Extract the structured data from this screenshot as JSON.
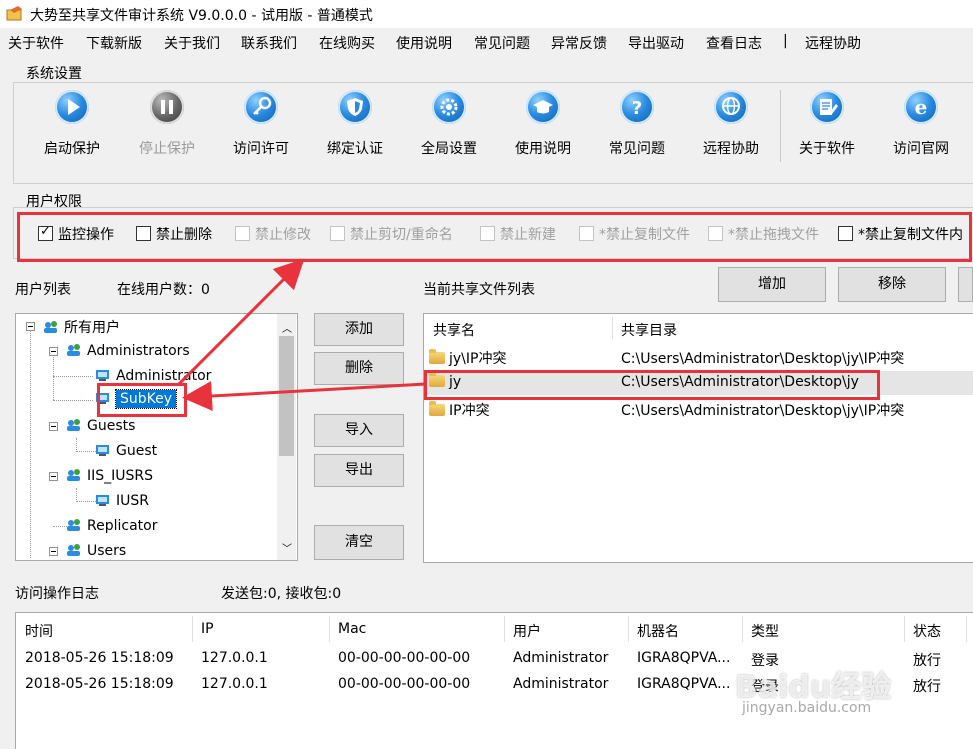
{
  "window": {
    "title": "大势至共享文件审计系统 V9.0.0.0 - 试用版 - 普通模式"
  },
  "menu": [
    "关于软件",
    "下载新版",
    "关于我们",
    "联系我们",
    "在线购买",
    "使用说明",
    "常见问题",
    "异常反馈",
    "导出驱动",
    "查看日志",
    "|",
    "远程协助"
  ],
  "system_settings": {
    "label": "系统设置",
    "buttons": [
      {
        "label": "启动保护",
        "icon": "play-icon",
        "enabled": true
      },
      {
        "label": "停止保护",
        "icon": "pause-icon",
        "enabled": false
      },
      {
        "label": "访问许可",
        "icon": "key-icon",
        "enabled": true
      },
      {
        "label": "绑定认证",
        "icon": "shield-icon",
        "enabled": true
      },
      {
        "label": "全局设置",
        "icon": "gear-icon",
        "enabled": true
      },
      {
        "label": "使用说明",
        "icon": "graduation-cap-icon",
        "enabled": true
      },
      {
        "label": "常见问题",
        "icon": "question-icon",
        "enabled": true
      },
      {
        "label": "远程协助",
        "icon": "globe-icon",
        "enabled": true
      },
      {
        "label": "关于软件",
        "icon": "document-edit-icon",
        "enabled": true
      },
      {
        "label": "访问官网",
        "icon": "ie-icon",
        "enabled": true
      }
    ]
  },
  "permissions": {
    "label": "用户权限",
    "items": [
      {
        "label": "监控操作",
        "checked": true,
        "enabled": true
      },
      {
        "label": "禁止删除",
        "checked": false,
        "enabled": true
      },
      {
        "label": "禁止修改",
        "checked": false,
        "enabled": false
      },
      {
        "label": "禁止剪切/重命名",
        "checked": false,
        "enabled": false
      },
      {
        "label": "禁止新建",
        "checked": false,
        "enabled": false
      },
      {
        "label": "*禁止复制文件",
        "checked": false,
        "enabled": false
      },
      {
        "label": "*禁止拖拽文件",
        "checked": false,
        "enabled": false
      },
      {
        "label": "*禁止复制文件内",
        "checked": false,
        "enabled": true
      }
    ]
  },
  "user_list": {
    "label": "用户列表",
    "online_label": "在线用户数：0",
    "tree": [
      {
        "label": "所有用户",
        "type": "group"
      },
      {
        "label": "Administrators",
        "type": "group"
      },
      {
        "label": "Administrator",
        "type": "user"
      },
      {
        "label": "SubKey",
        "type": "user",
        "selected": true
      },
      {
        "label": "Guests",
        "type": "group"
      },
      {
        "label": "Guest",
        "type": "user"
      },
      {
        "label": "IIS_IUSRS",
        "type": "group"
      },
      {
        "label": "IUSR",
        "type": "user"
      },
      {
        "label": "Replicator",
        "type": "group"
      },
      {
        "label": "Users",
        "type": "group"
      }
    ]
  },
  "middle_buttons": [
    "添加",
    "删除",
    "导入",
    "导出",
    "清空"
  ],
  "shared_files": {
    "label": "当前共享文件列表",
    "add_button": "增加",
    "remove_button": "移除",
    "columns": [
      "共享名",
      "共享目录"
    ],
    "rows": [
      {
        "name": "jy\\IP冲突",
        "path": "C:\\Users\\Administrator\\Desktop\\jy\\IP冲突"
      },
      {
        "name": "jy",
        "path": "C:\\Users\\Administrator\\Desktop\\jy"
      },
      {
        "name": "IP冲突",
        "path": "C:\\Users\\Administrator\\Desktop\\jy\\IP冲突"
      }
    ]
  },
  "log": {
    "label": "访问操作日志",
    "stats": "发送包:0, 接收包:0",
    "columns": [
      "时间",
      "IP",
      "Mac",
      "用户",
      "机器名",
      "类型",
      "状态"
    ],
    "rows": [
      [
        "2018-05-26 15:18:09",
        "127.0.0.1",
        "00-00-00-00-00-00",
        "Administrator",
        "IGRA8QPVA...",
        "登录",
        "放行"
      ],
      [
        "2018-05-26 15:18:09",
        "127.0.0.1",
        "00-00-00-00-00-00",
        "Administrator",
        "IGRA8QPVA...",
        "登录",
        "放行"
      ]
    ]
  },
  "watermark": "Baidu经验 jingyan.baidu.com",
  "colors": {
    "annotation_red": "#e8333c",
    "selection_blue": "#0078d7",
    "icon_blue": "#2a8be0"
  }
}
